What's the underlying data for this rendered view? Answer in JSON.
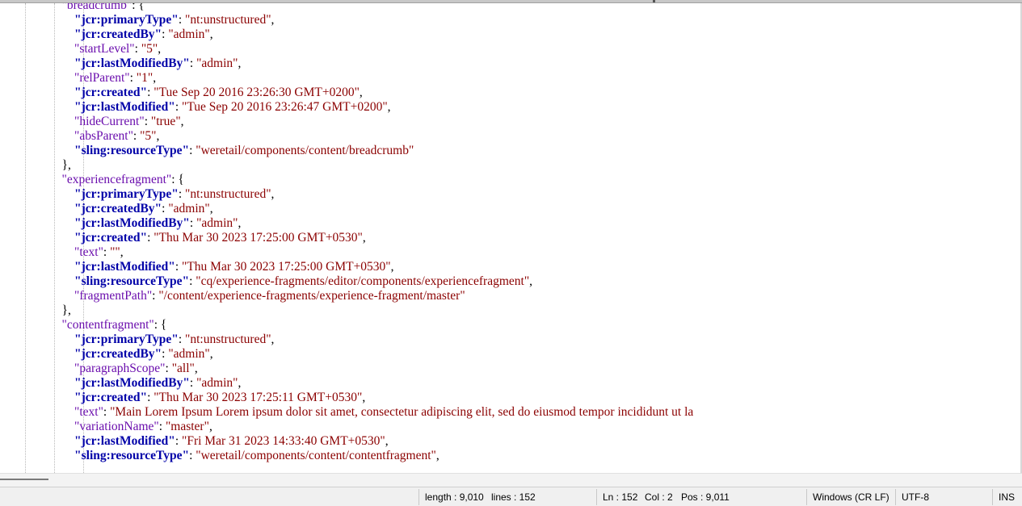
{
  "editor": {
    "lines": [
      {
        "indent": "            ",
        "key": "\"breadcrumb\"",
        "kclass": "k1",
        "sep": ": ",
        "val": "",
        "tail": "{"
      },
      {
        "indent": "                ",
        "key": "\"jcr:primaryType\"",
        "kclass": "k2",
        "sep": ": ",
        "val": "\"nt:unstructured\"",
        "tail": ","
      },
      {
        "indent": "                ",
        "key": "\"jcr:createdBy\"",
        "kclass": "k2",
        "sep": ": ",
        "val": "\"admin\"",
        "tail": ","
      },
      {
        "indent": "                ",
        "key": "\"startLevel\"",
        "kclass": "k1",
        "sep": ": ",
        "val": "\"5\"",
        "tail": ","
      },
      {
        "indent": "                ",
        "key": "\"jcr:lastModifiedBy\"",
        "kclass": "k2",
        "sep": ": ",
        "val": "\"admin\"",
        "tail": ","
      },
      {
        "indent": "                ",
        "key": "\"relParent\"",
        "kclass": "k1",
        "sep": ": ",
        "val": "\"1\"",
        "tail": ","
      },
      {
        "indent": "                ",
        "key": "\"jcr:created\"",
        "kclass": "k2",
        "sep": ": ",
        "val": "\"Tue Sep 20 2016 23:26:30 GMT+0200\"",
        "tail": ","
      },
      {
        "indent": "                ",
        "key": "\"jcr:lastModified\"",
        "kclass": "k2",
        "sep": ": ",
        "val": "\"Tue Sep 20 2016 23:26:47 GMT+0200\"",
        "tail": ","
      },
      {
        "indent": "                ",
        "key": "\"hideCurrent\"",
        "kclass": "k1",
        "sep": ": ",
        "val": "\"true\"",
        "tail": ","
      },
      {
        "indent": "                ",
        "key": "\"absParent\"",
        "kclass": "k1",
        "sep": ": ",
        "val": "\"5\"",
        "tail": ","
      },
      {
        "indent": "                ",
        "key": "\"sling:resourceType\"",
        "kclass": "k2",
        "sep": ": ",
        "val": "\"weretail/components/content/breadcrumb\"",
        "tail": ""
      },
      {
        "indent": "            ",
        "key": "",
        "kclass": "k1",
        "sep": "",
        "val": "",
        "tail": "},"
      },
      {
        "indent": "            ",
        "key": "\"experiencefragment\"",
        "kclass": "k1",
        "sep": ": ",
        "val": "",
        "tail": "{"
      },
      {
        "indent": "                ",
        "key": "\"jcr:primaryType\"",
        "kclass": "k2",
        "sep": ": ",
        "val": "\"nt:unstructured\"",
        "tail": ","
      },
      {
        "indent": "                ",
        "key": "\"jcr:createdBy\"",
        "kclass": "k2",
        "sep": ": ",
        "val": "\"admin\"",
        "tail": ","
      },
      {
        "indent": "                ",
        "key": "\"jcr:lastModifiedBy\"",
        "kclass": "k2",
        "sep": ": ",
        "val": "\"admin\"",
        "tail": ","
      },
      {
        "indent": "                ",
        "key": "\"jcr:created\"",
        "kclass": "k2",
        "sep": ": ",
        "val": "\"Thu Mar 30 2023 17:25:00 GMT+0530\"",
        "tail": ","
      },
      {
        "indent": "                ",
        "key": "\"text\"",
        "kclass": "k1",
        "sep": ": ",
        "val": "\"\"",
        "tail": ","
      },
      {
        "indent": "                ",
        "key": "\"jcr:lastModified\"",
        "kclass": "k2",
        "sep": ": ",
        "val": "\"Thu Mar 30 2023 17:25:00 GMT+0530\"",
        "tail": ","
      },
      {
        "indent": "                ",
        "key": "\"sling:resourceType\"",
        "kclass": "k2",
        "sep": ": ",
        "val": "\"cq/experience-fragments/editor/components/experiencefragment\"",
        "tail": ","
      },
      {
        "indent": "                ",
        "key": "\"fragmentPath\"",
        "kclass": "k1",
        "sep": ": ",
        "val": "\"/content/experience-fragments/experience-fragment/master\"",
        "tail": ""
      },
      {
        "indent": "            ",
        "key": "",
        "kclass": "k1",
        "sep": "",
        "val": "",
        "tail": "},"
      },
      {
        "indent": "            ",
        "key": "\"contentfragment\"",
        "kclass": "k1",
        "sep": ": ",
        "val": "",
        "tail": "{"
      },
      {
        "indent": "                ",
        "key": "\"jcr:primaryType\"",
        "kclass": "k2",
        "sep": ": ",
        "val": "\"nt:unstructured\"",
        "tail": ","
      },
      {
        "indent": "                ",
        "key": "\"jcr:createdBy\"",
        "kclass": "k2",
        "sep": ": ",
        "val": "\"admin\"",
        "tail": ","
      },
      {
        "indent": "                ",
        "key": "\"paragraphScope\"",
        "kclass": "k1",
        "sep": ": ",
        "val": "\"all\"",
        "tail": ","
      },
      {
        "indent": "                ",
        "key": "\"jcr:lastModifiedBy\"",
        "kclass": "k2",
        "sep": ": ",
        "val": "\"admin\"",
        "tail": ","
      },
      {
        "indent": "                ",
        "key": "\"jcr:created\"",
        "kclass": "k2",
        "sep": ": ",
        "val": "\"Thu Mar 30 2023 17:25:11 GMT+0530\"",
        "tail": ","
      },
      {
        "indent": "                ",
        "key": "\"text\"",
        "kclass": "k1",
        "sep": ": ",
        "val": "\"Main Lorem Ipsum Lorem ipsum dolor sit amet, consectetur adipiscing elit, sed do eiusmod tempor incididunt ut la",
        "tail": ""
      },
      {
        "indent": "                ",
        "key": "\"variationName\"",
        "kclass": "k1",
        "sep": ": ",
        "val": "\"master\"",
        "tail": ","
      },
      {
        "indent": "                ",
        "key": "\"jcr:lastModified\"",
        "kclass": "k2",
        "sep": ": ",
        "val": "\"Fri Mar 31 2023 14:33:40 GMT+0530\"",
        "tail": ","
      },
      {
        "indent": "                ",
        "key": "\"sling:resourceType\"",
        "kclass": "k2",
        "sep": ": ",
        "val": "\"weretail/components/content/contentfragment\"",
        "tail": ","
      }
    ]
  },
  "statusbar": {
    "length": "length : 9,010",
    "lines": "lines : 152",
    "ln": "Ln : 152",
    "col": "Col : 2",
    "pos": "Pos : 9,011",
    "eol": "Windows (CR LF)",
    "encoding": "UTF-8",
    "mode": "INS"
  }
}
